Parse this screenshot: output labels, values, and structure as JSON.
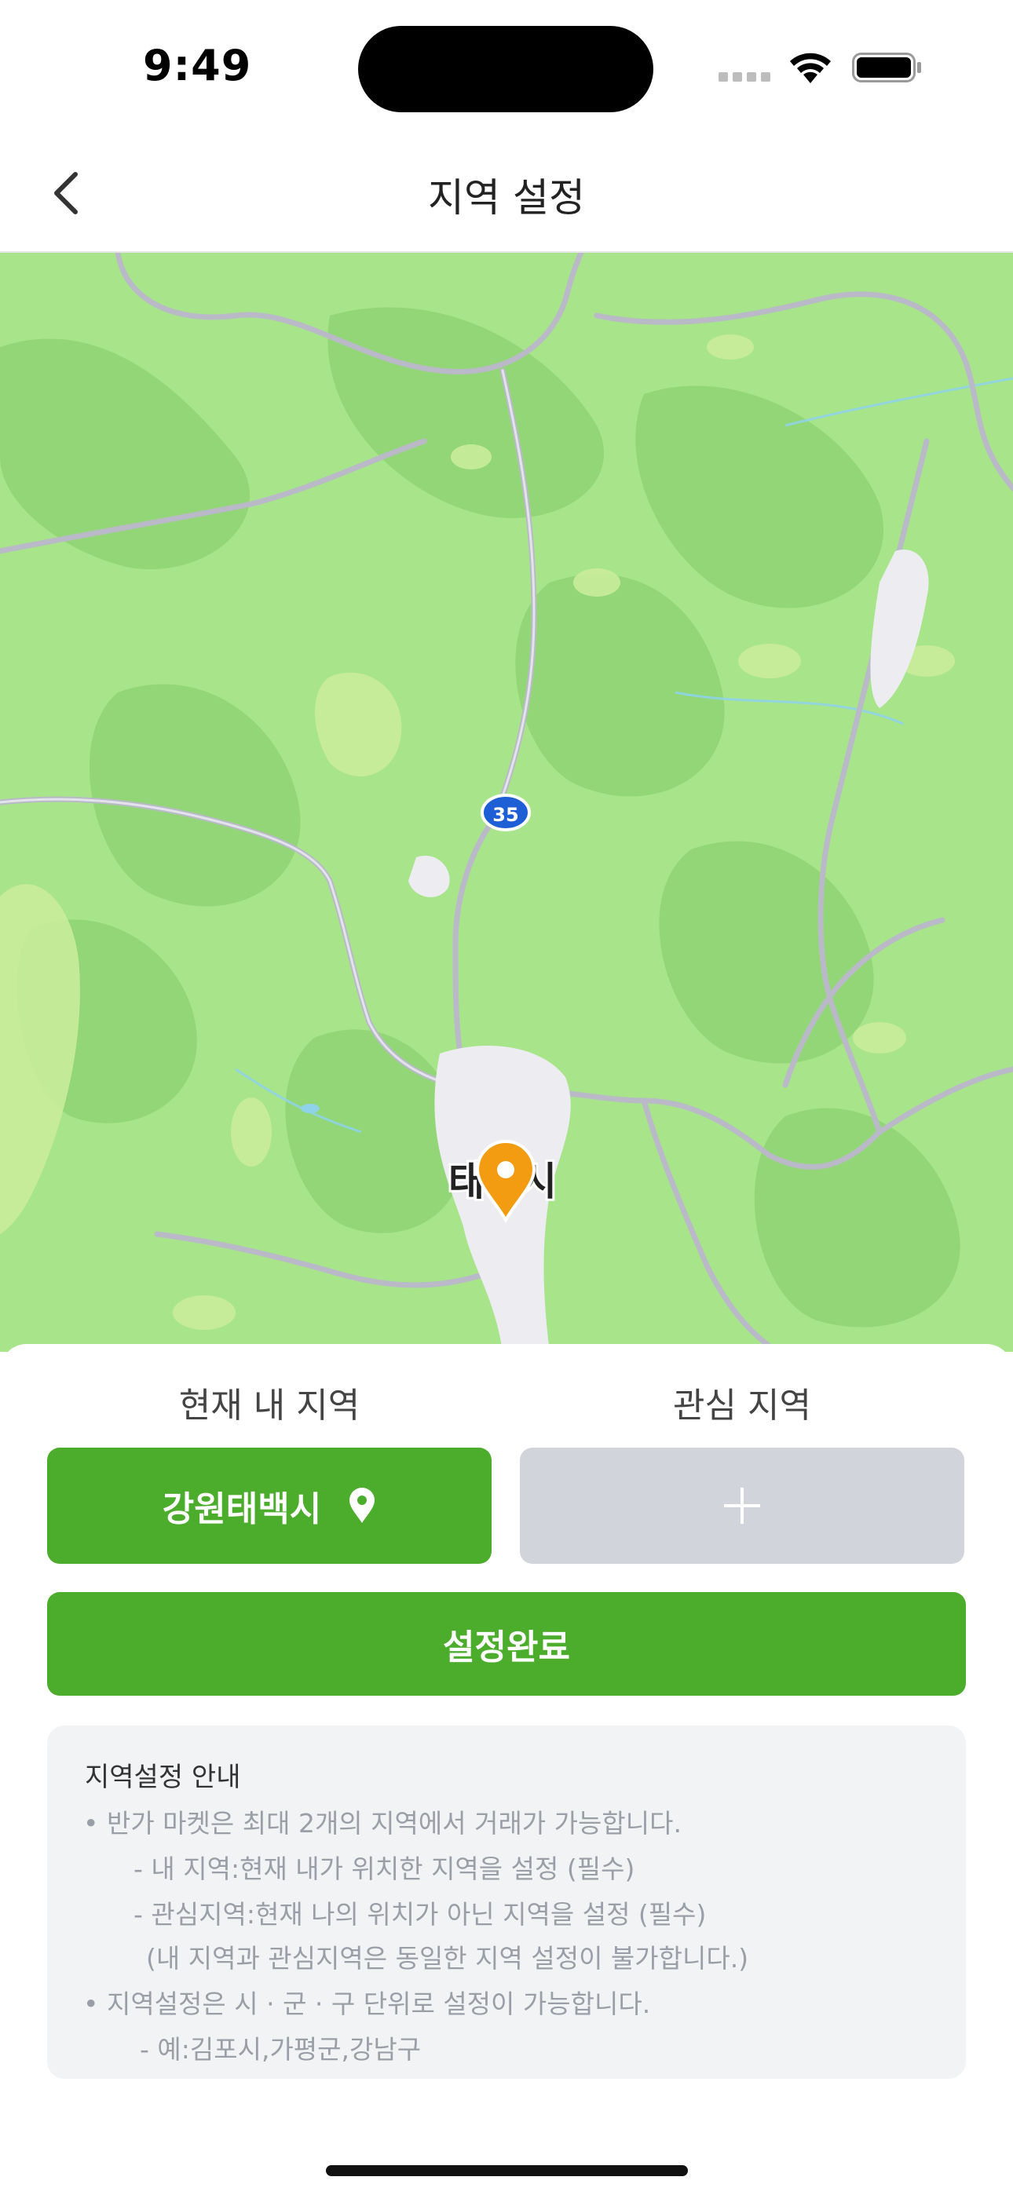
{
  "status_bar": {
    "time": "9:49"
  },
  "nav": {
    "title": "지역 설정"
  },
  "map": {
    "city_label": "태백시",
    "route_number": "35",
    "colors": {
      "land": "#a8e48a",
      "forest_dark": "#86cf6c",
      "road": "#b9b9c8",
      "water": "#8fd3e8",
      "pin": "#f39c12"
    }
  },
  "sheet": {
    "current_label": "현재 내 지역",
    "interest_label": "관심 지역",
    "current_region": "강원태백시",
    "confirm_label": "설정완료",
    "info": {
      "title": "지역설정 안내",
      "lines": [
        "• 반가 마켓은 최대 2개의 지역에서 거래가 가능합니다.",
        "- 내 지역:현재 내가 위치한 지역을 설정 (필수)",
        "- 관심지역:현재 나의 위치가 아닌 지역을 설정 (필수)",
        "(내 지역과 관심지역은 동일한 지역 설정이 불가합니다.)",
        "• 지역설정은 시 · 군 · 구 단위로 설정이 가능합니다.",
        "- 예:김포시,가평군,강남구"
      ]
    }
  },
  "colors": {
    "accent": "#4cac2c",
    "disabled": "#d2d4dc",
    "info_bg": "#f2f3f5"
  }
}
